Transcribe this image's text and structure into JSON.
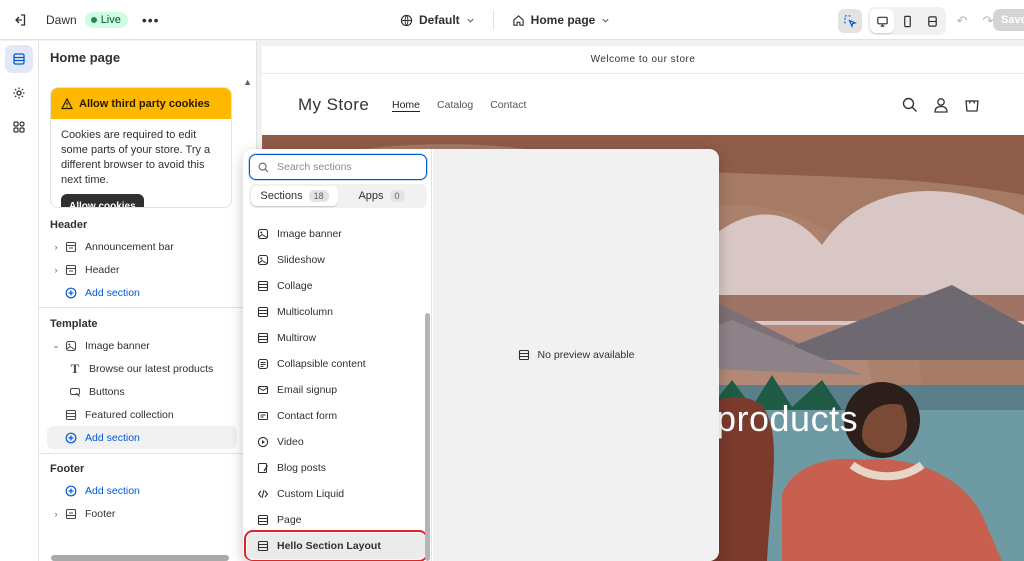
{
  "topbar": {
    "theme_name": "Dawn",
    "status": "Live",
    "more": "•••",
    "theme_selector": "Default",
    "page_selector": "Home page",
    "save_label": "Save"
  },
  "sidebar": {
    "title": "Home page",
    "cookie_banner": {
      "title": "Allow third party cookies",
      "body": "Cookies are required to edit some parts of your store. Try a different browser to avoid this next time.",
      "button": "Allow cookies"
    },
    "header_group": {
      "title": "Header",
      "items": [
        "Announcement bar",
        "Header"
      ],
      "add_label": "Add section"
    },
    "template_group": {
      "title": "Template",
      "image_banner": "Image banner",
      "image_banner_children": [
        "Browse our latest products",
        "Buttons"
      ],
      "featured": "Featured collection",
      "add_label": "Add section"
    },
    "footer_group": {
      "title": "Footer",
      "add_label": "Add section",
      "items": [
        "Footer"
      ]
    }
  },
  "picker": {
    "search_placeholder": "Search sections",
    "tabs": [
      {
        "label": "Sections",
        "count": "18"
      },
      {
        "label": "Apps",
        "count": "0"
      }
    ],
    "sections": [
      {
        "label": "Image banner",
        "icon": "image-icon"
      },
      {
        "label": "Slideshow",
        "icon": "slideshow-icon"
      },
      {
        "label": "Collage",
        "icon": "layout-icon"
      },
      {
        "label": "Multicolumn",
        "icon": "layout-icon"
      },
      {
        "label": "Multirow",
        "icon": "layout-icon"
      },
      {
        "label": "Collapsible content",
        "icon": "collapsible-icon"
      },
      {
        "label": "Email signup",
        "icon": "email-icon"
      },
      {
        "label": "Contact form",
        "icon": "form-icon"
      },
      {
        "label": "Video",
        "icon": "play-icon"
      },
      {
        "label": "Blog posts",
        "icon": "blog-icon"
      },
      {
        "label": "Custom Liquid",
        "icon": "code-icon"
      },
      {
        "label": "Page",
        "icon": "layout-icon"
      },
      {
        "label": "Hello Section Layout",
        "icon": "layout-icon"
      }
    ],
    "no_preview": "No preview available"
  },
  "preview": {
    "announcement": "Welcome to our store",
    "store_name": "My Store",
    "nav": [
      "Home",
      "Catalog",
      "Contact"
    ],
    "hero_text": "products"
  },
  "colors": {
    "accent": "#005bd3",
    "warning": "#ffb800",
    "live_bg": "#cdfee1",
    "highlight_border": "#e02424"
  }
}
